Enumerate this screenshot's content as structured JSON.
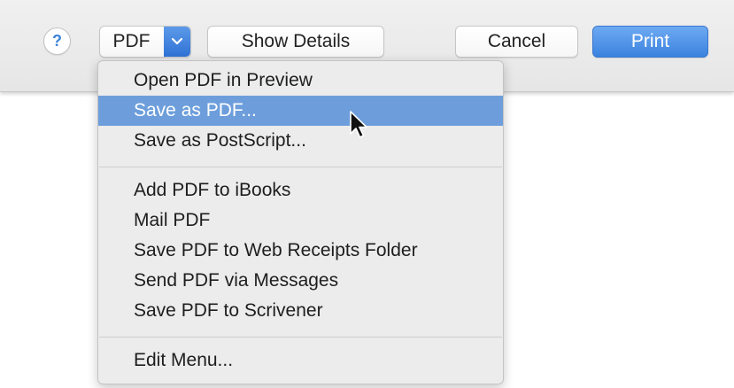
{
  "toolbar": {
    "help_label": "?",
    "pdf_label": "PDF",
    "show_details_label": "Show Details",
    "cancel_label": "Cancel",
    "print_label": "Print"
  },
  "menu": {
    "items": [
      {
        "label": "Open PDF in Preview",
        "selected": false
      },
      {
        "label": "Save as PDF...",
        "selected": true
      },
      {
        "label": "Save as PostScript...",
        "selected": false
      },
      {
        "label": "Add PDF to iBooks",
        "selected": false
      },
      {
        "label": "Mail PDF",
        "selected": false
      },
      {
        "label": "Save PDF to Web Receipts Folder",
        "selected": false
      },
      {
        "label": "Send PDF via Messages",
        "selected": false
      },
      {
        "label": "Save PDF to Scrivener",
        "selected": false
      },
      {
        "label": "Edit Menu...",
        "selected": false
      }
    ]
  },
  "colors": {
    "accent": "#3b82df",
    "selection": "#6d9edb",
    "toolbar_bg": "#ebebeb",
    "menu_bg": "#ececec"
  },
  "icons": {
    "help": "help-icon",
    "popup_arrow": "chevron-down-icon",
    "cursor": "mouse-pointer-icon"
  }
}
